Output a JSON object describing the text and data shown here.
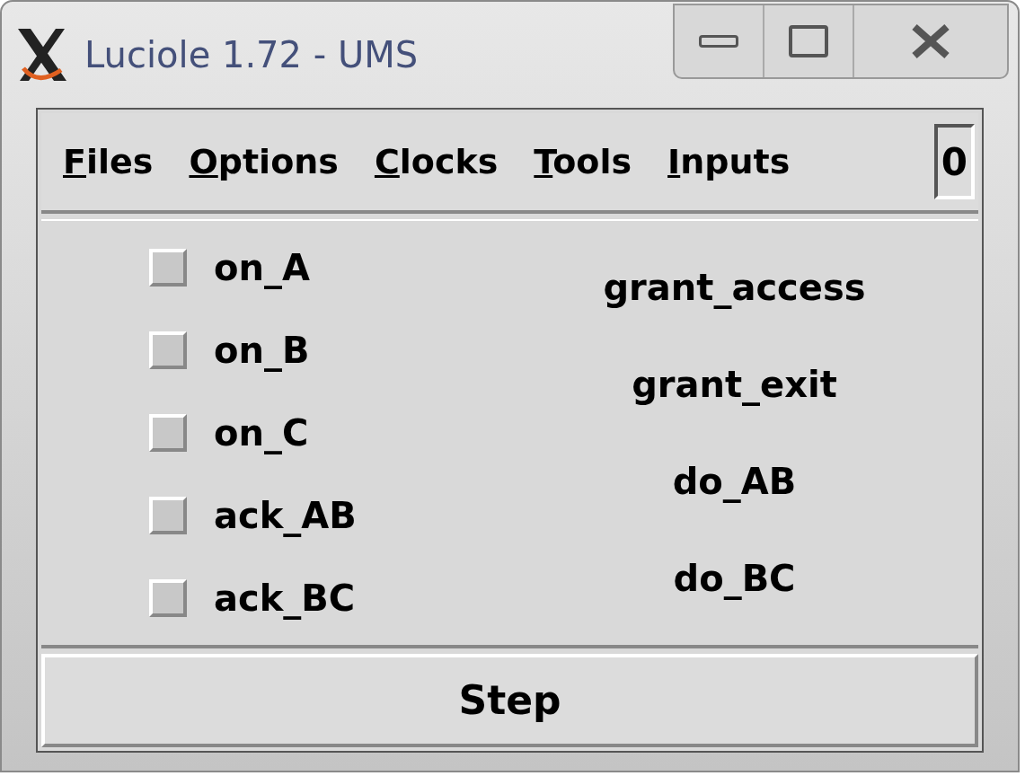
{
  "window": {
    "title": "Luciole 1.72 - UMS"
  },
  "menu": [
    {
      "label": "Files"
    },
    {
      "label": "Options"
    },
    {
      "label": "Clocks"
    },
    {
      "label": "Tools"
    },
    {
      "label": "Inputs"
    }
  ],
  "counter": "0",
  "inputs": [
    {
      "label": "on_A",
      "checked": false
    },
    {
      "label": "on_B",
      "checked": false
    },
    {
      "label": "on_C",
      "checked": false
    },
    {
      "label": "ack_AB",
      "checked": false
    },
    {
      "label": "ack_BC",
      "checked": false
    }
  ],
  "outputs": [
    "grant_access",
    "grant_exit",
    "do_AB",
    "do_BC"
  ],
  "step_button": "Step"
}
